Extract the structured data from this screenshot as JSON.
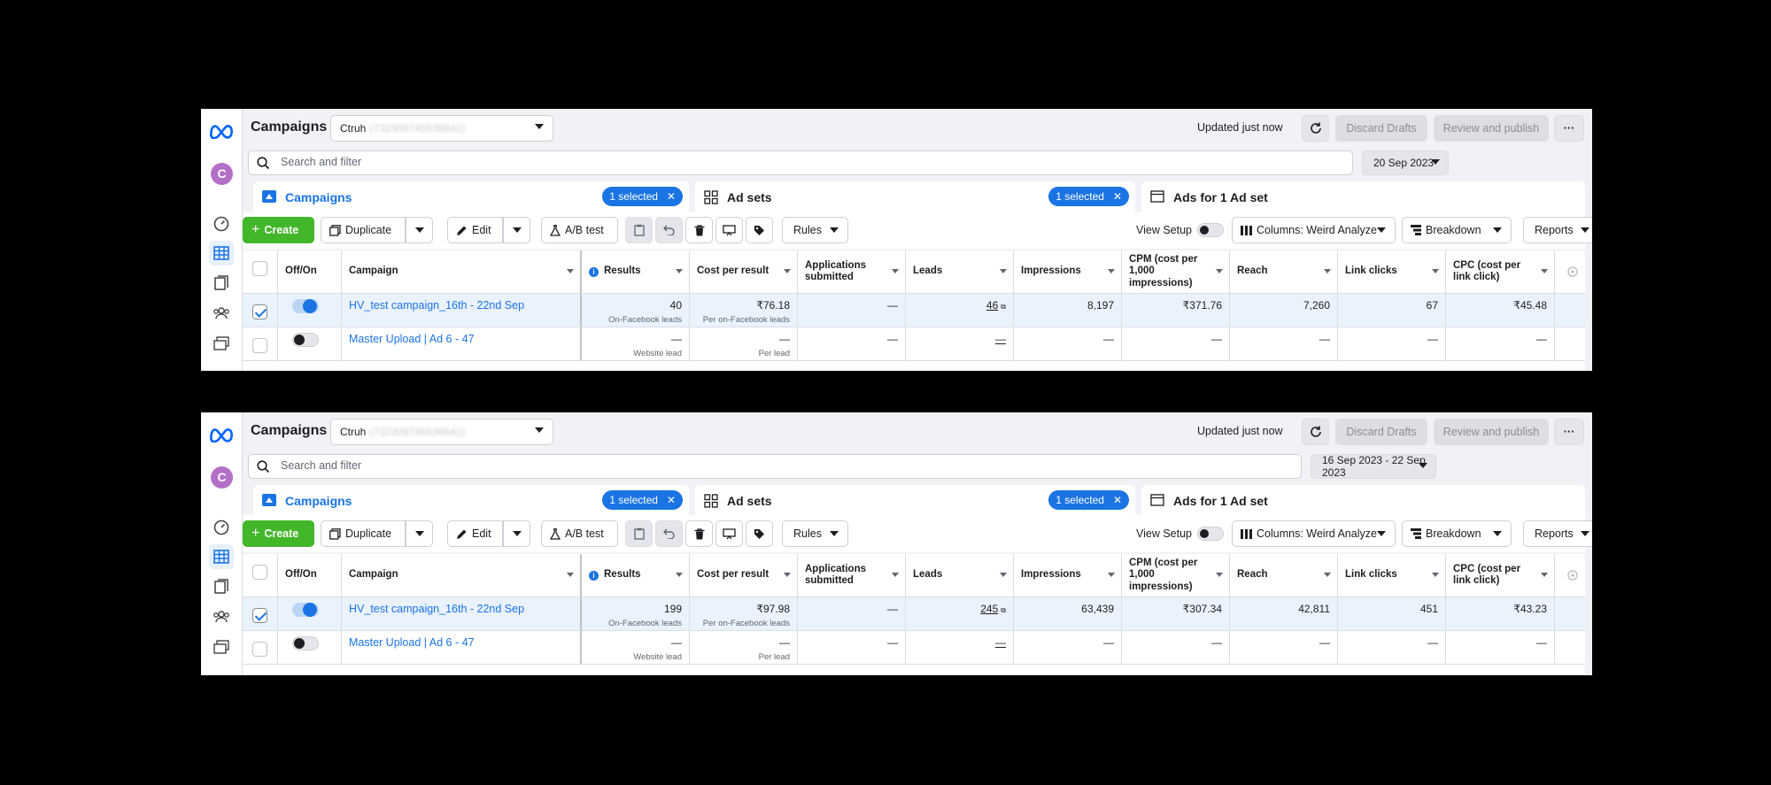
{
  "panels": [
    {
      "title": "Campaigns",
      "account": {
        "name": "Ctruh",
        "id": "(732309745536641)"
      },
      "status": "Updated just now",
      "discard_label": "Discard Drafts",
      "review_label": "Review and publish",
      "more_label": "···",
      "search_placeholder": "Search and filter",
      "date_range": "20 Sep 2023",
      "tabs": {
        "campaigns": {
          "label": "Campaigns",
          "badge": "1 selected"
        },
        "adsets": {
          "label": "Ad sets",
          "badge": "1 selected"
        },
        "ads": {
          "label": "Ads for 1 Ad set"
        }
      },
      "toolbar": {
        "create": "Create",
        "duplicate": "Duplicate",
        "edit": "Edit",
        "abtest": "A/B test",
        "rules": "Rules",
        "view_setup": "View Setup",
        "columns": "Columns: Weird Analyze",
        "breakdown": "Breakdown",
        "reports": "Reports"
      },
      "columns": [
        "Off/On",
        "Campaign",
        "Results",
        "Cost per result",
        "Applications submitted",
        "Leads",
        "Impressions",
        "CPM (cost per 1,000 impressions)",
        "Reach",
        "Link clicks",
        "CPC (cost per link click)"
      ],
      "rows": [
        {
          "selected": true,
          "on": true,
          "name": "HV_test campaign_16th - 22nd Sep",
          "results": "40",
          "results_sub": "On-Facebook leads",
          "cpr": "₹76.18",
          "cpr_sub": "Per on-Facebook leads",
          "apps": "—",
          "leads": "46",
          "impressions": "8,197",
          "cpm": "₹371.76",
          "reach": "7,260",
          "clicks": "67",
          "cpc": "₹45.48"
        },
        {
          "selected": false,
          "on": false,
          "name": "Master Upload | Ad 6 - 47",
          "results": "—",
          "results_sub": "Website lead",
          "cpr": "—",
          "cpr_sub": "Per lead",
          "apps": "—",
          "leads": "—",
          "impressions": "—",
          "cpm": "—",
          "reach": "—",
          "clicks": "—",
          "cpc": "—"
        }
      ]
    },
    {
      "title": "Campaigns",
      "account": {
        "name": "Ctruh",
        "id": "(732309745536641)"
      },
      "status": "Updated just now",
      "discard_label": "Discard Drafts",
      "review_label": "Review and publish",
      "more_label": "···",
      "search_placeholder": "Search and filter",
      "date_range": "16 Sep 2023 - 22 Sep 2023",
      "tabs": {
        "campaigns": {
          "label": "Campaigns",
          "badge": "1 selected"
        },
        "adsets": {
          "label": "Ad sets",
          "badge": "1 selected"
        },
        "ads": {
          "label": "Ads for 1 Ad set"
        }
      },
      "toolbar": {
        "create": "Create",
        "duplicate": "Duplicate",
        "edit": "Edit",
        "abtest": "A/B test",
        "rules": "Rules",
        "view_setup": "View Setup",
        "columns": "Columns: Weird Analyze",
        "breakdown": "Breakdown",
        "reports": "Reports"
      },
      "columns": [
        "Off/On",
        "Campaign",
        "Results",
        "Cost per result",
        "Applications submitted",
        "Leads",
        "Impressions",
        "CPM (cost per 1,000 impressions)",
        "Reach",
        "Link clicks",
        "CPC (cost per link click)"
      ],
      "rows": [
        {
          "selected": true,
          "on": true,
          "name": "HV_test campaign_16th - 22nd Sep",
          "results": "199",
          "results_sub": "On-Facebook leads",
          "cpr": "₹97.98",
          "cpr_sub": "Per on-Facebook leads",
          "apps": "—",
          "leads": "245",
          "impressions": "63,439",
          "cpm": "₹307.34",
          "reach": "42,811",
          "clicks": "451",
          "cpc": "₹43.23"
        },
        {
          "selected": false,
          "on": false,
          "name": "Master Upload | Ad 6 - 47",
          "results": "—",
          "results_sub": "Website lead",
          "cpr": "—",
          "cpr_sub": "Per lead",
          "apps": "—",
          "leads": "—",
          "impressions": "—",
          "cpm": "—",
          "reach": "—",
          "clicks": "—",
          "cpc": "—"
        }
      ]
    }
  ],
  "colors": {
    "accent": "#1b74e4",
    "create": "#42b72a",
    "avatar": "#b46fc9"
  },
  "rail": {
    "avatar_letter": "C",
    "icons": [
      "meta-logo-icon",
      "dashboard-icon",
      "campaign-table-icon",
      "pages-icon",
      "audience-icon",
      "ad-library-icon"
    ]
  }
}
